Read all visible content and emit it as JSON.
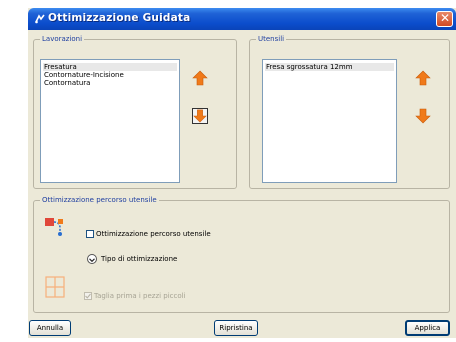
{
  "window": {
    "title": "Ottimizzazione Guidata",
    "close_glyph": "✕"
  },
  "lavorazioni": {
    "legend": "Lavorazioni",
    "items": [
      "Fresatura",
      "Contornature-Incisione",
      "Contornatura"
    ],
    "selected_index": 0
  },
  "utensili": {
    "legend": "Utensili",
    "items": [
      "Fresa sgrossatura 12mm"
    ],
    "selected_index": 0
  },
  "ottimizzazione": {
    "legend": "Ottimizzazione percorso utensile",
    "checkbox_label": "Ottimizzazione percorso utensile",
    "checkbox_checked": false,
    "tipo_label": "Tipo di ottimizzazione",
    "small_pieces_label": "Taglia prima i pezzi piccoli",
    "small_pieces_checked": true,
    "small_pieces_enabled": false
  },
  "footer": {
    "cancel_label": "Annulla",
    "reset_label": "Ripristina",
    "apply_label": "Applica"
  },
  "colors": {
    "title_bar": "#0b4dcc",
    "legend_text": "#1f3fa0",
    "arrow_orange": "#f07a1a"
  },
  "icons": {
    "title": "app-icon",
    "up": "arrow-up-icon",
    "down": "arrow-down-icon",
    "tool_path": "tool-path-icon",
    "expand": "chevron-down-icon",
    "pieces": "nesting-pieces-icon"
  }
}
